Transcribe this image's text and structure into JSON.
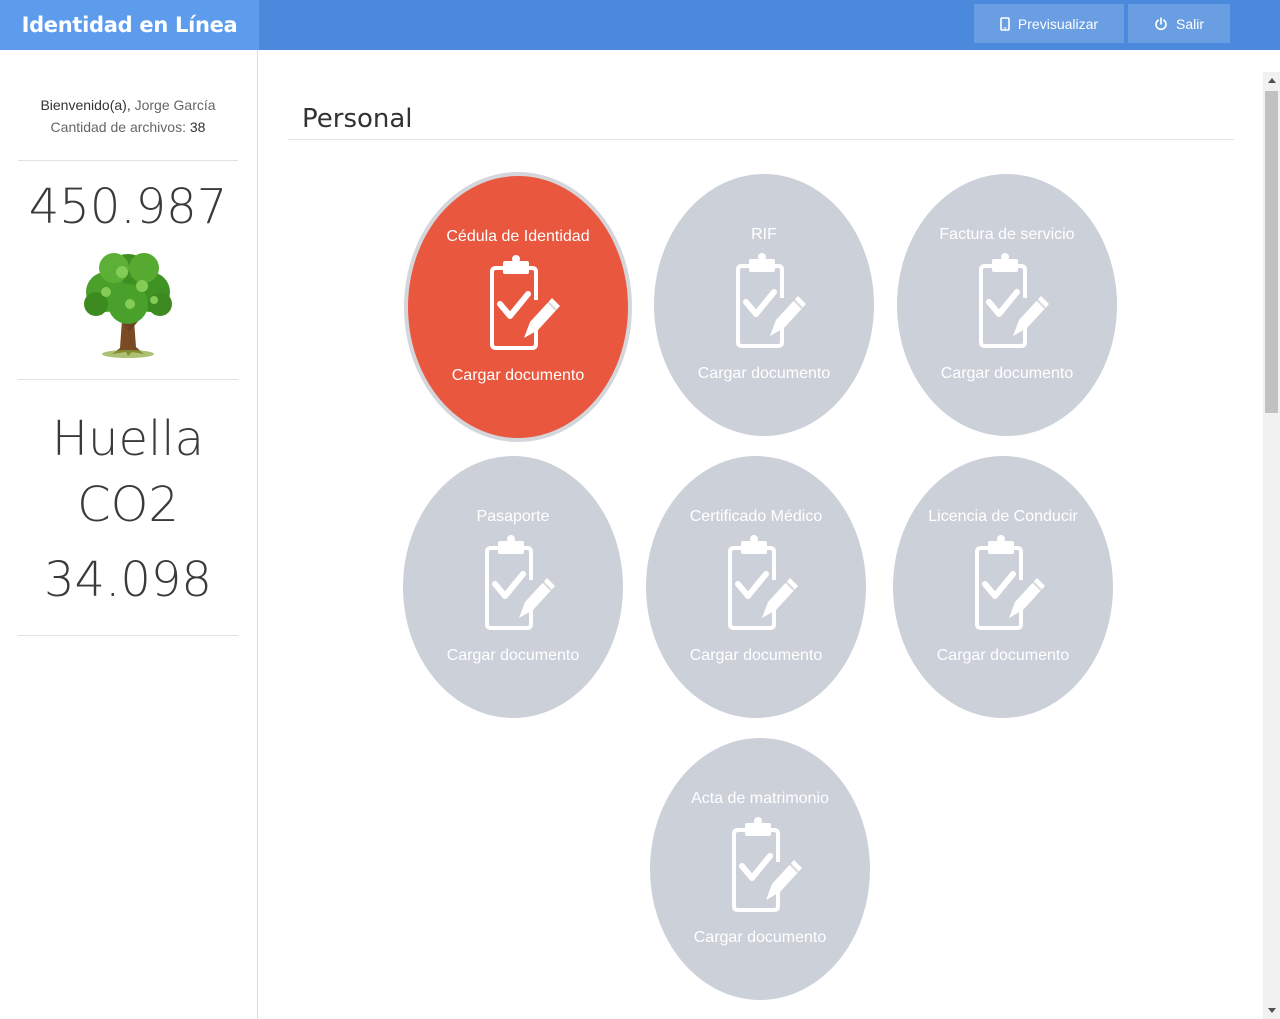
{
  "header": {
    "brand": "Identidad en Línea",
    "preview_label": "Previsualizar",
    "exit_label": "Salir"
  },
  "sidebar": {
    "welcome_prefix": "Bienvenido(a),",
    "user_name": "Jorge García",
    "files_label": "Cantidad de archivos:",
    "files_count": "38",
    "big_number": "450.987",
    "footprint_line1": "Huella",
    "footprint_line2": "CO2",
    "footprint_value": "34.098"
  },
  "main": {
    "section_title": "Personal",
    "cards": [
      {
        "title": "Cédula de Identidad",
        "action": "Cargar documento"
      },
      {
        "title": "RIF",
        "action": "Cargar documento"
      },
      {
        "title": "Factura de servicio",
        "action": "Cargar documento"
      },
      {
        "title": "Pasaporte",
        "action": "Cargar documento"
      },
      {
        "title": "Certificado Médico",
        "action": "Cargar documento"
      },
      {
        "title": "Licencia de Conducir",
        "action": "Cargar documento"
      },
      {
        "title": "Acta de matrimonio",
        "action": "Cargar documento"
      }
    ]
  },
  "colors": {
    "topbar": "#4a89dc",
    "brand_bg": "#5d9cec",
    "active_card": "#e9573f",
    "inactive_card": "#ccd0d9"
  },
  "icons": {
    "preview": "mobile-icon",
    "exit": "power-icon",
    "card": "clipboard-check-icon",
    "tree": "tree-icon"
  }
}
